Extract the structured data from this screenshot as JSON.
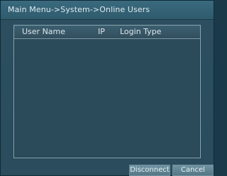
{
  "window": {
    "title": "Main Menu->System->Online Users"
  },
  "table": {
    "columns": {
      "user_name": "User Name",
      "ip": "IP",
      "login_type": "Login Type"
    },
    "rows": []
  },
  "buttons": {
    "disconnect": "Disconnect",
    "cancel": "Cancel"
  },
  "colors": {
    "background": "#2a4c5c",
    "titlebar": "#346273",
    "panel_border": "#88a5b2",
    "text": "#dde7ec"
  }
}
